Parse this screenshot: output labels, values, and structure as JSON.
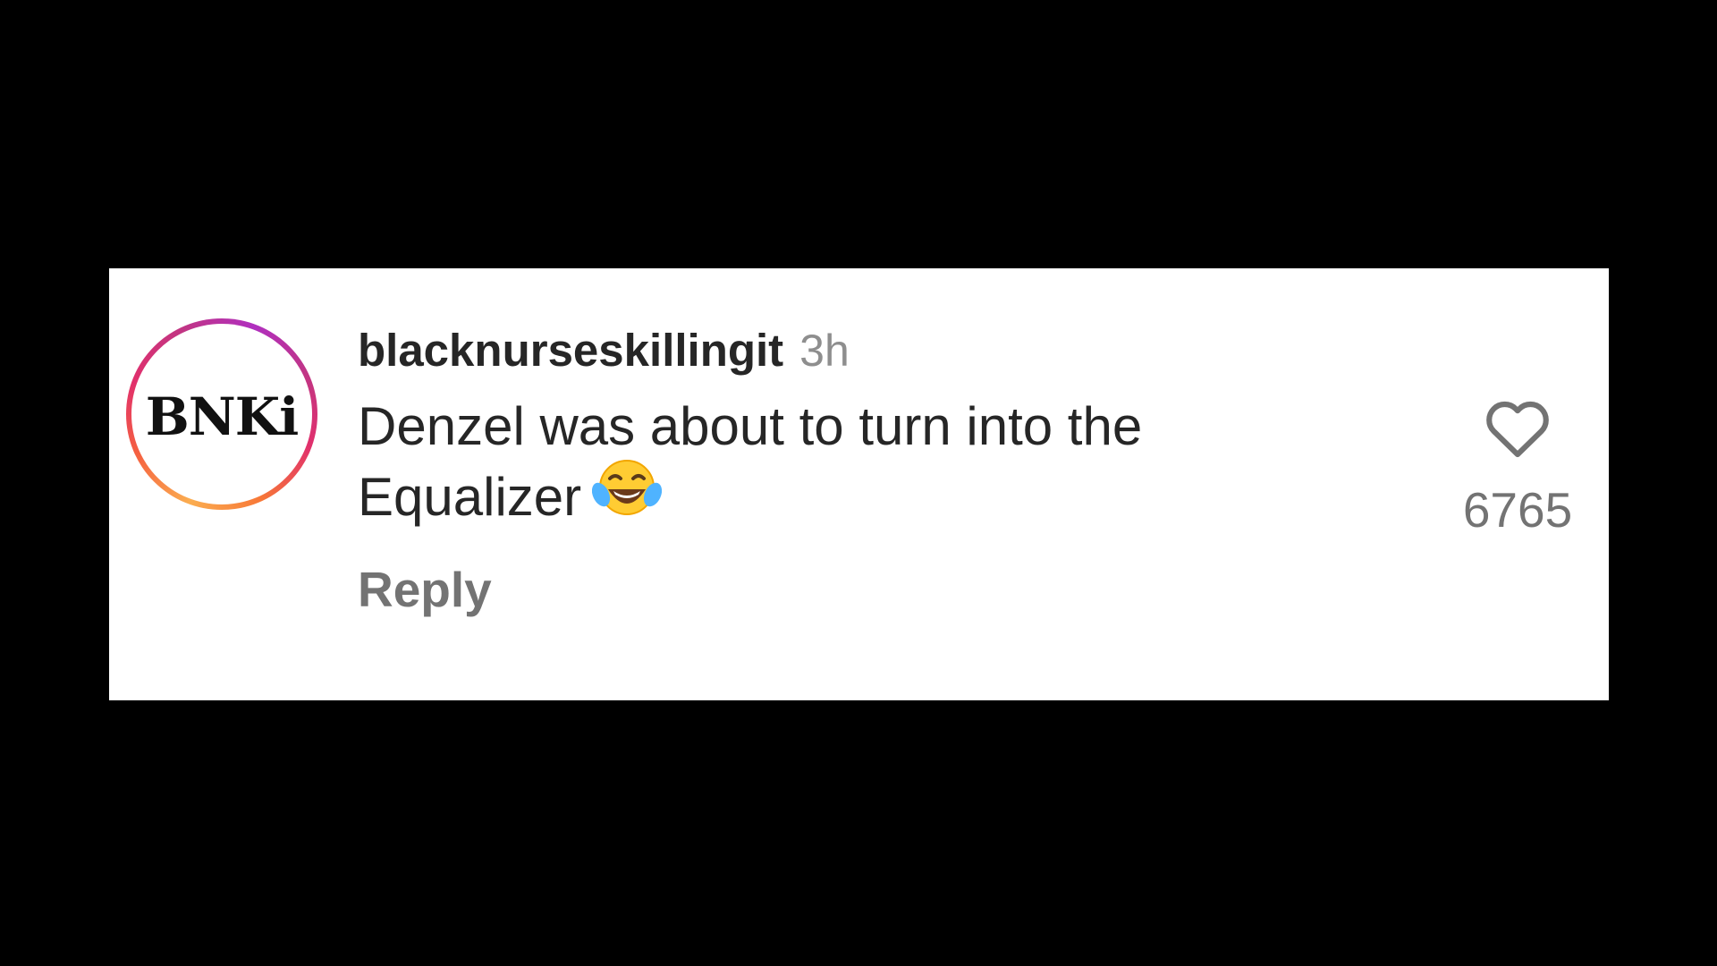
{
  "comment": {
    "avatar_logo_text": "BNKi",
    "username": "blacknurseskillingit",
    "timestamp": "3h",
    "text": "Denzel was about to turn into the Equalizer",
    "emoji_icon": "face-with-tears-of-joy",
    "reply_label": "Reply",
    "like_icon": "heart-outline-icon",
    "like_count": "6765"
  },
  "colors": {
    "background": "#000000",
    "card": "#ffffff",
    "text_primary": "#262626",
    "text_secondary": "#8e8e8e"
  }
}
